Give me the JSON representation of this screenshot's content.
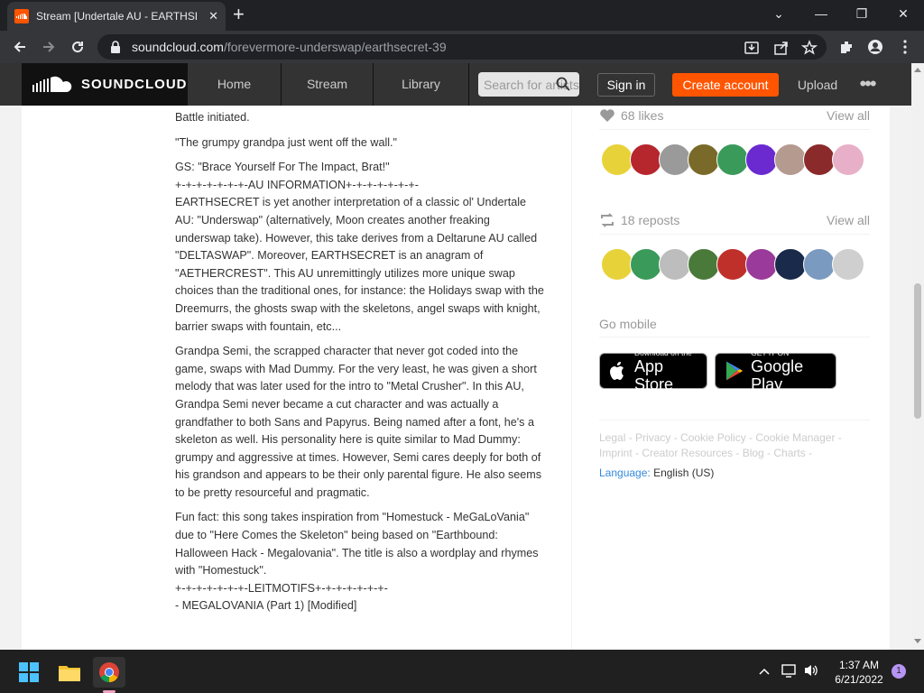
{
  "browser": {
    "tab_title": "Stream [Undertale AU - EARTHSECRET] - MEGALOVANIA",
    "tab_close": "✕",
    "new_tab": "+",
    "url_host": "soundcloud.com",
    "url_path": "/forevermore-underswap/earthsecret-39",
    "window": {
      "minimize": "—",
      "maximize": "❐",
      "close": "✕",
      "dropdown": "⌄"
    }
  },
  "header": {
    "logo_text": "SOUNDCLOUD",
    "nav": [
      "Home",
      "Stream",
      "Library"
    ],
    "search_placeholder": "Search for artists, bands, tracks, podcasts",
    "signin": "Sign in",
    "create_account": "Create account",
    "upload": "Upload",
    "more": "•••"
  },
  "description": [
    "Battle initiated.",
    "\"The grumpy grandpa just went off the wall.\"",
    "GS: \"Brace Yourself For The Impact, Brat!\"\n+-+-+-+-+-+-+-AU INFORMATION+-+-+-+-+-+-+-\nEARTHSECRET is yet another interpretation of a classic ol' Undertale AU: \"Underswap\" (alternatively, Moon creates another freaking underswap take). However, this take derives from a Deltarune AU called \"DELTASWAP\". Moreover, EARTHSECRET is an anagram of \"AETHERCREST\". This AU unremittingly utilizes more unique swap choices than the traditional ones, for instance: the Holidays swap with the Dreemurrs, the ghosts swap with the skeletons, angel swaps with knight, barrier swaps with fountain, etc...",
    "Grandpa Semi, the scrapped character that never got coded into the game, swaps with Mad Dummy. For the very least, he was given a short melody that was later used for the intro to \"Metal Crusher\". In this AU, Grandpa Semi never became a cut character and was actually a grandfather to both Sans and Papyrus. Being named after a font, he's a skeleton as well. His personality here is quite similar to Mad Dummy: grumpy and aggressive at times. However, Semi cares deeply for both of his grandson and appears to be their only parental figure. He also seems to be pretty resourceful and pragmatic.",
    "Fun fact: this song takes inspiration from \"Homestuck - MeGaLoVania\" due to \"Here Comes the Skeleton\" being based on \"Earthbound: Halloween Hack - Megalovania\". The title is also a wordplay and rhymes with \"Homestuck\".\n+-+-+-+-+-+-+-LEITMOTIFS+-+-+-+-+-+-+-\n- MEGALOVANIA (Part 1) [Modified]"
  ],
  "sidebar": {
    "likes": "68 likes",
    "reposts": "18 reposts",
    "view_all": "View all",
    "go_mobile": "Go mobile",
    "appstore_small": "Download on the",
    "appstore_big": "App Store",
    "gplay_small": "GET IT ON",
    "gplay_big": "Google Play",
    "footer_links": "Legal - Privacy - Cookie Policy - Cookie Manager - Imprint - Creator Resources - Blog - Charts -",
    "language_label": "Language:",
    "language_value": "English (US)",
    "like_avatar_colors": [
      "#e8d23a",
      "#b5262d",
      "#9a9a9a",
      "#7a6a2a",
      "#3a9a5a",
      "#6a2ad0",
      "#b59a90",
      "#8a2a2a",
      "#e8b0c8"
    ],
    "repost_avatar_colors": [
      "#e8d23a",
      "#3a9a5a",
      "#bdbdbd",
      "#4a7a3a",
      "#c0302a",
      "#9a3a9a",
      "#1a2a4a",
      "#7a9ac0",
      "#cfcfcf"
    ]
  },
  "taskbar": {
    "time": "1:37 AM",
    "date": "6/21/2022",
    "notifications": "1"
  }
}
